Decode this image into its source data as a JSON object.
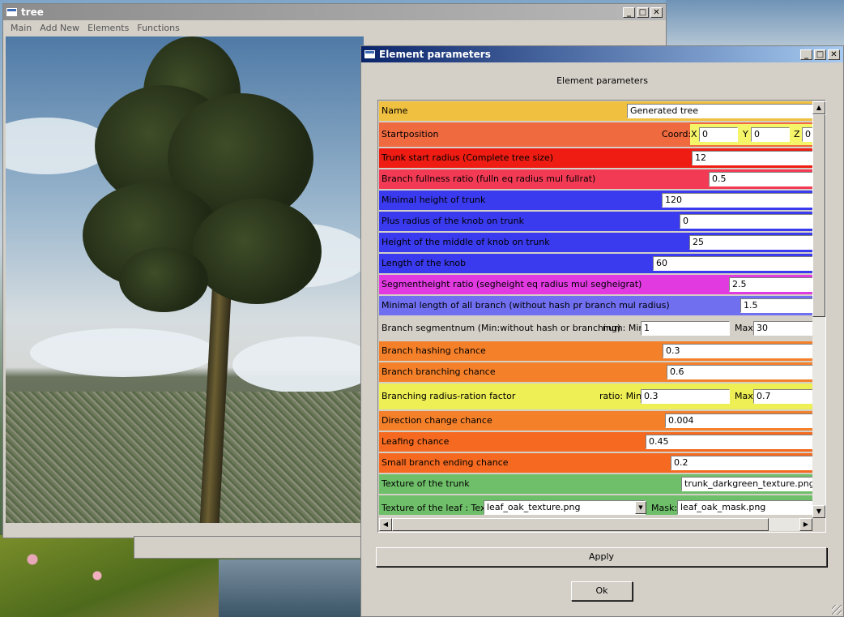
{
  "tree_window": {
    "title": "tree",
    "menu": [
      "Main",
      "Add New",
      "Elements",
      "Functions"
    ],
    "buttons": {
      "minimize": "_",
      "maximize": "□",
      "close": "✕"
    }
  },
  "param_window": {
    "title": "Element parameters",
    "heading": "Element parameters",
    "buttons": {
      "minimize": "_",
      "maximize": "□",
      "close": "✕"
    },
    "apply_label": "Apply",
    "ok_label": "Ok",
    "rows": [
      {
        "label": "Name",
        "color": "#f0c040",
        "value": "Generated tree"
      },
      {
        "label": "Startposition",
        "color": "#f06a40",
        "coord_label": "Coord:",
        "x_label": "X",
        "x": "0",
        "y_label": "Y",
        "y": "0",
        "z_label": "Z",
        "z": "0"
      },
      {
        "label": "Trunk start radius (Complete tree size)",
        "color": "#ee1c12",
        "value": "12"
      },
      {
        "label": "Branch fullness ratio (fulln eq radius mul fullrat)",
        "color": "#f33a55",
        "value": "0.5"
      },
      {
        "label": "Minimal height of trunk",
        "color": "#3a3aee",
        "value": "120"
      },
      {
        "label": "Plus radius of the knob on trunk",
        "color": "#3a3aee",
        "value": "0"
      },
      {
        "label": "Height of the middle of knob on trunk",
        "color": "#3a3aee",
        "value": "25"
      },
      {
        "label": "Length of the knob",
        "color": "#3a3aee",
        "value": "60"
      },
      {
        "label": "Segmentheight ratio (segheight eq radius mul segheigrat)",
        "color": "#e03ae0",
        "value": "2.5"
      },
      {
        "label": "Minimal length of all branch (without hash pr branch mul radius)",
        "color": "#6f6ff0",
        "value": "1.5"
      },
      {
        "label": "Branch segmentnum (Min:without hash or branching)",
        "color": "#d4d0c8",
        "num_label": "num: Min",
        "min": "1",
        "max_label": "Max",
        "max": "30"
      },
      {
        "label": "Branch hashing chance",
        "color": "#f5802a",
        "value": "0.3"
      },
      {
        "label": "Branch branching chance",
        "color": "#f5802a",
        "value": "0.6"
      },
      {
        "label": "Branching radius-ration factor",
        "color": "#eeee55",
        "ratio_label": "ratio: Min",
        "min": "0.3",
        "max_label": "Max",
        "max": "0.7"
      },
      {
        "label": "Direction change chance",
        "color": "#f5802a",
        "value": "0.004"
      },
      {
        "label": "Leafing chance",
        "color": "#f56a20",
        "value": "0.45"
      },
      {
        "label": "Small branch ending chance",
        "color": "#f56a20",
        "value": "0.2"
      },
      {
        "label": "Texture of the trunk",
        "color": "#6fbf6a",
        "value": "trunk_darkgreen_texture.png"
      },
      {
        "label": "Texture of the leaf : Tex:",
        "color": "#6fbf6a",
        "tex": "leaf_oak_texture.png",
        "mask_label": "Mask:",
        "mask": "leaf_oak_mask.png"
      }
    ]
  }
}
